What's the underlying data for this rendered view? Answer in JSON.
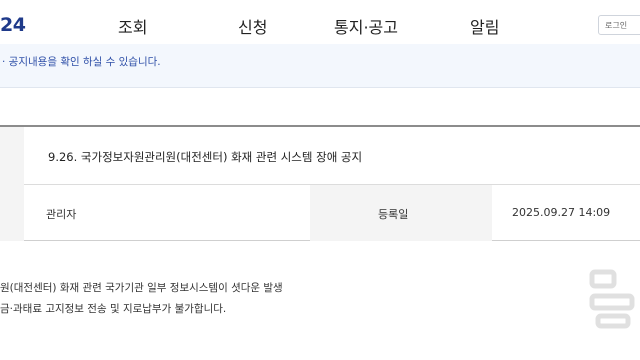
{
  "header": {
    "logo": "24",
    "nav": [
      "조회",
      "신청",
      "통지·공고",
      "알림"
    ],
    "login_label": "로그인"
  },
  "notice": {
    "text": "· 공지내용을 확인 하실 수 있습니다."
  },
  "post": {
    "title": "9.26. 국가정보자원관리원(대전센터) 화재 관련 시스템 장애 공지",
    "writer": "관리자",
    "date_label": "등록일",
    "date_value": "2025.09.27 14:09"
  },
  "body": {
    "line1": "원(대전센터) 화재 관련 국가기관 일부 정보시스템이 셧다운 발생",
    "line2": "금·과태료 고지정보 전송 및 지로납부가 불가합니다."
  },
  "colors": {
    "brand": "#1f3a8a",
    "notice_text": "#2e4fa8",
    "notice_bg": "#f3f7fd",
    "cell_bg": "#f4f4f4"
  },
  "icons": {
    "watermark": "broadcaster-watermark-icon"
  }
}
